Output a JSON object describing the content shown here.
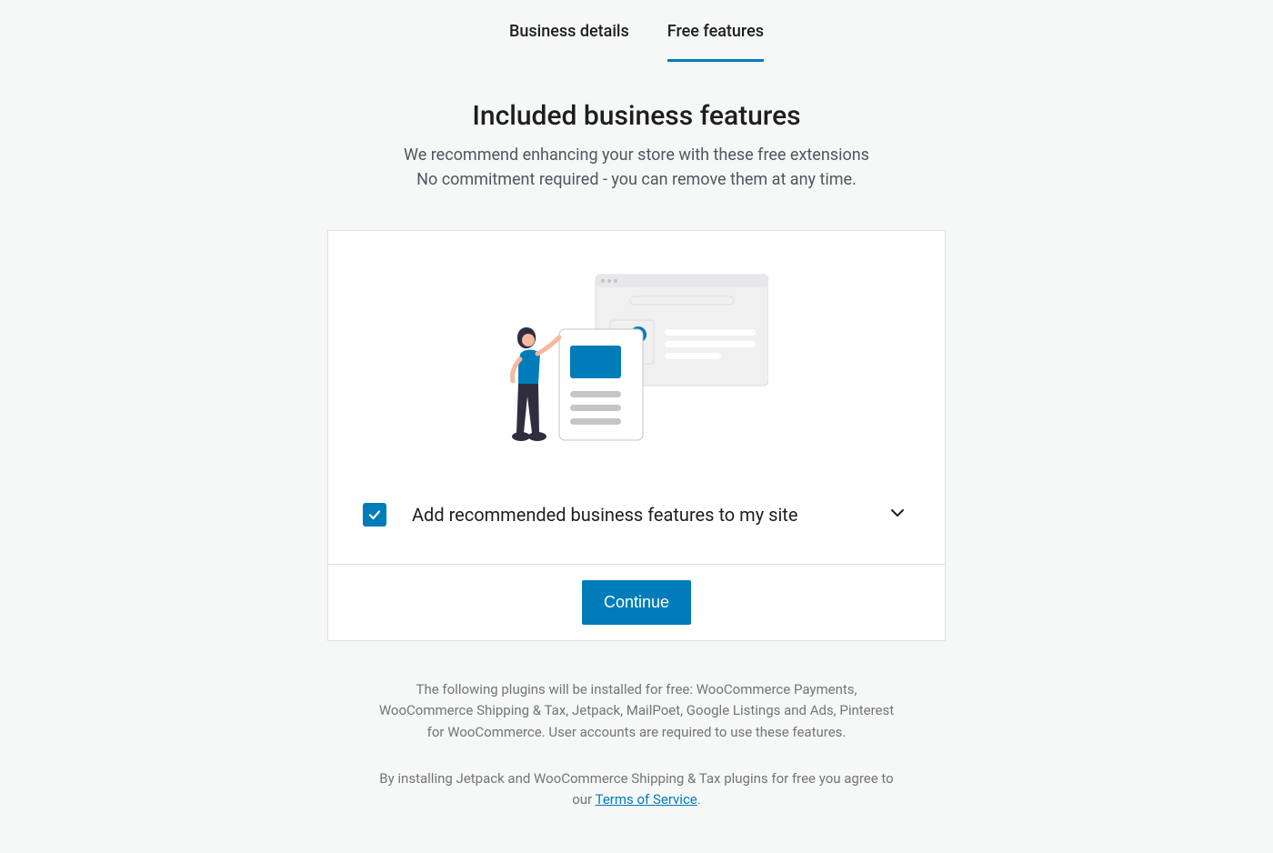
{
  "tabs": {
    "business_details": "Business details",
    "free_features": "Free features"
  },
  "header": {
    "title": "Included business features",
    "subtitle_line1": "We recommend enhancing your store with these free extensions",
    "subtitle_line2": "No commitment required - you can remove them at any time."
  },
  "checkbox": {
    "label": "Add recommended business features to my site",
    "checked": true
  },
  "actions": {
    "continue": "Continue"
  },
  "footer": {
    "disclaimer": "The following plugins will be installed for free: WooCommerce Payments, WooCommerce Shipping & Tax, Jetpack, MailPoet, Google Listings and Ads, Pinterest for WooCommerce. User accounts are required to use these features.",
    "terms_prefix": "By installing Jetpack and WooCommerce Shipping & Tax plugins for free you agree to our ",
    "terms_link": "Terms of Service",
    "terms_suffix": "."
  },
  "colors": {
    "accent": "#007cba"
  }
}
